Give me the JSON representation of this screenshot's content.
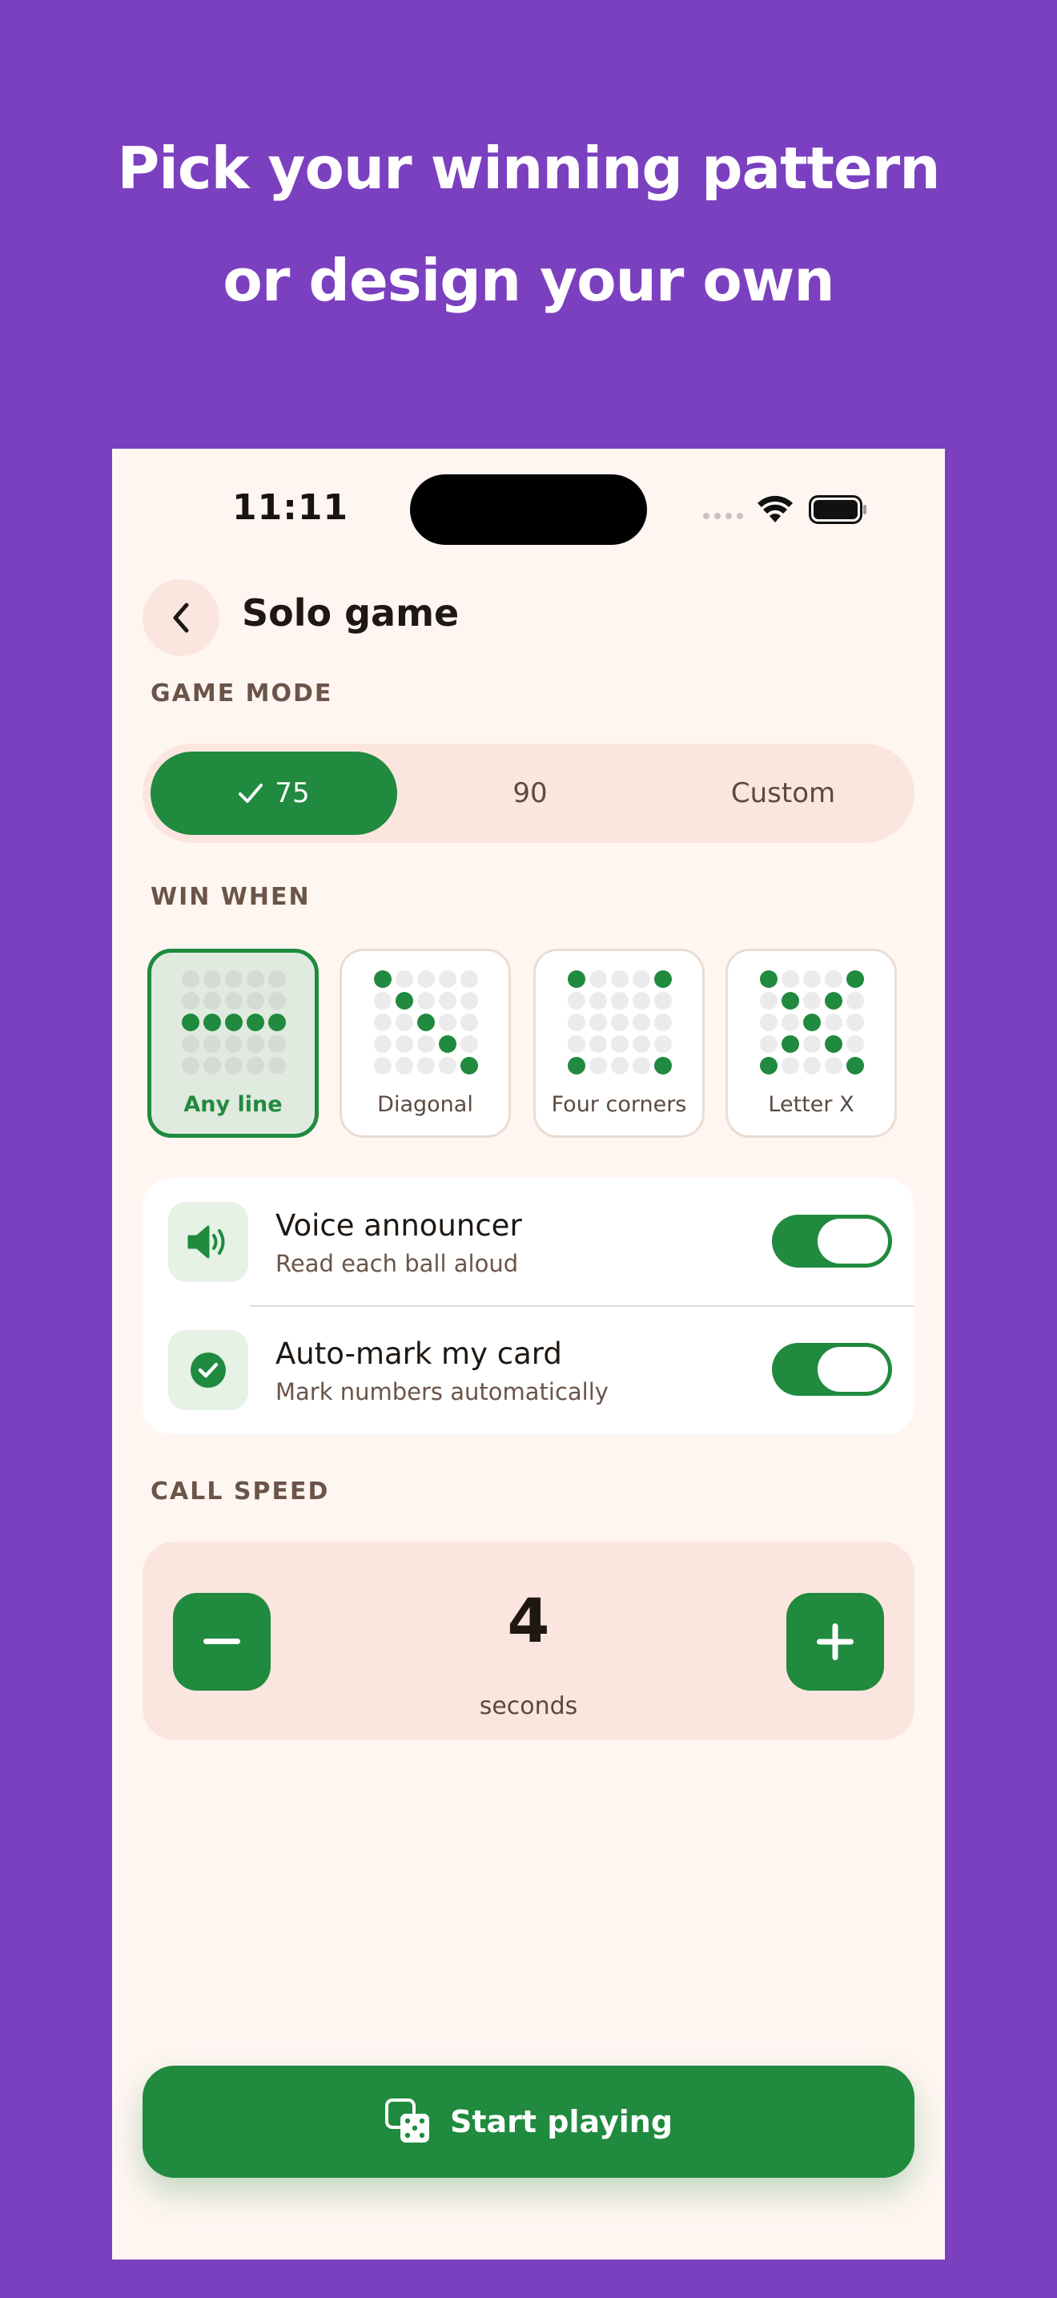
{
  "headline": {
    "line1": "Pick your winning pattern",
    "line2": "or design your own"
  },
  "status_bar": {
    "time": "11:11"
  },
  "header": {
    "title": "Solo game"
  },
  "game_mode": {
    "label": "GAME MODE",
    "options": [
      {
        "label": "75",
        "selected": true
      },
      {
        "label": "90",
        "selected": false
      },
      {
        "label": "Custom",
        "selected": false
      }
    ]
  },
  "win_when": {
    "label": "WIN WHEN",
    "patterns": [
      {
        "label": "Any line",
        "selected": true
      },
      {
        "label": "Diagonal",
        "selected": false
      },
      {
        "label": "Four corners",
        "selected": false
      },
      {
        "label": "Letter X",
        "selected": false
      }
    ]
  },
  "settings": [
    {
      "title": "Voice announcer",
      "subtitle": "Read each ball aloud",
      "icon": "speaker-icon",
      "enabled": true
    },
    {
      "title": "Auto-mark my card",
      "subtitle": "Mark numbers automatically",
      "icon": "check-circle-icon",
      "enabled": true
    }
  ],
  "call_speed": {
    "label": "CALL SPEED",
    "value": "4",
    "unit": "seconds"
  },
  "start_button": {
    "label": "Start playing",
    "icon": "dice-icon"
  },
  "colors": {
    "background": "#7b40c0",
    "accent": "#208a3e",
    "surface": "#fff6f2",
    "soft": "#fbe6df"
  }
}
